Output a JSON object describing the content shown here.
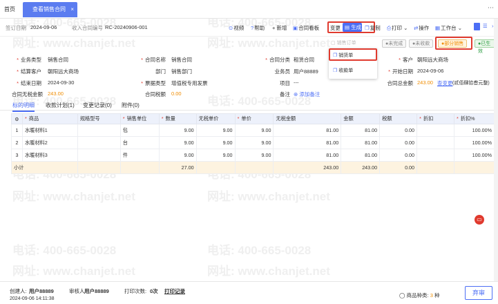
{
  "tabs": {
    "home": "首页",
    "active": "查看销售合同",
    "close": "×"
  },
  "toolbar": {
    "sign_date_label": "签订日期",
    "sign_date": "2024-09-06",
    "contract_no_label": "收入合同编号",
    "contract_no": "RC-20240906-001",
    "video": "视频",
    "help": "帮助",
    "add": "+ 新增",
    "board": "合同看板",
    "change": "变更",
    "generate": "生成",
    "copy": "复制",
    "print": "打印",
    "ops": "操作",
    "workbench": "工作台"
  },
  "dropdown": {
    "disabled": "销售订单",
    "items": [
      "销货单",
      "收款单"
    ]
  },
  "statuses": {
    "unfinished": "未完成",
    "unpaid": "未收款",
    "pending": "部分销售",
    "effective": "已生效"
  },
  "form": {
    "biz_type_label": "业务类型",
    "biz_type": "销售合同",
    "name_label": "合同名称",
    "name": "销售合同",
    "category_label": "合同分类",
    "category": "租赁合同",
    "customer_label": "客户",
    "customer": "朝阳远大商场",
    "settle_customer_label": "结算客户",
    "settle_customer": "朝阳远大商场",
    "dept_label": "部门",
    "dept": "销售部门",
    "salesman_label": "业务员",
    "salesman": "用户88889",
    "start_date_label": "开始日期",
    "start_date": "2024-09-06",
    "end_date_label": "结束日期",
    "end_date": "2024-09-30",
    "invoice_type_label": "票据类型",
    "invoice_type": "增值税专用发票",
    "project_label": "项目",
    "project": "---",
    "total_label": "合同总金额",
    "total": "243.00",
    "view_change": "查变更",
    "uppercase": "(贰佰肆拾叁元整)",
    "no_tax_label": "合同无税金额",
    "no_tax": "243.00",
    "tax_label": "合同税额",
    "tax": "0.00",
    "remark_label": "备注",
    "add_remark": "添加备注"
  },
  "subtabs": [
    "标的明细",
    "收款计划(1)",
    "变更记录(0)",
    "附件(0)"
  ],
  "table": {
    "headers": [
      "商品",
      "规格型号",
      "销售单位",
      "数量",
      "无税单价",
      "单价",
      "无税金额",
      "金额",
      "税额",
      "折扣",
      "折扣%"
    ],
    "rows": [
      [
        "1",
        "水暖材料1",
        "",
        "包",
        "9.00",
        "9.00",
        "9.00",
        "81.00",
        "81.00",
        "0.00",
        "",
        "100.00%"
      ],
      [
        "2",
        "水暖材料2",
        "",
        "台",
        "9.00",
        "9.00",
        "9.00",
        "81.00",
        "81.00",
        "0.00",
        "",
        "100.00%"
      ],
      [
        "3",
        "水暖材料3",
        "",
        "件",
        "9.00",
        "9.00",
        "9.00",
        "81.00",
        "81.00",
        "0.00",
        "",
        "100.00%"
      ]
    ],
    "subtotal": {
      "label": "小计",
      "qty": "27.00",
      "no_tax_amt": "243.00",
      "amt": "243.00",
      "tax": "0.00"
    }
  },
  "footer": {
    "creator_label": "创建人:",
    "creator": "用户88889",
    "created": "2024-09-06 14:11:38",
    "reviewer_label": "审核人:",
    "reviewer": "用户88889",
    "print_label": "打印次数:",
    "print_count": "0次",
    "print_record": "打印记录",
    "kinds_label": "商品种类:",
    "kinds": "3",
    "kinds_unit": "种",
    "review_btn": "弃审"
  },
  "watermark": {
    "phone": "电话: 400-665-0028",
    "site": "网址: www.chanjet.net"
  }
}
